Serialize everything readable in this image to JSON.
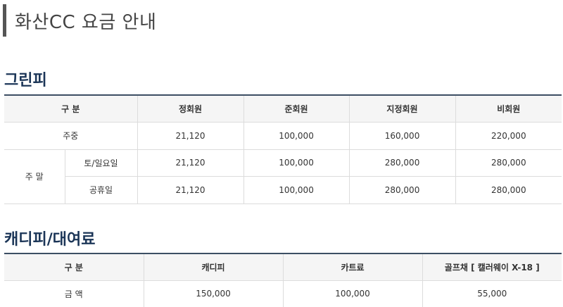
{
  "page": {
    "title": "화산CC 요금 안내"
  },
  "greenfee": {
    "title": "그린피",
    "headers": {
      "category": "구 분",
      "col1": "정회원",
      "col2": "준회원",
      "col3": "지정회원",
      "col4": "비회원"
    },
    "rows": {
      "weekday": {
        "label": "주중",
        "v1": "21,120",
        "v2": "100,000",
        "v3": "160,000",
        "v4": "220,000"
      },
      "weekend_label": "주 말",
      "weekend_sat_sun": {
        "label": "토/일요일",
        "v1": "21,120",
        "v2": "100,000",
        "v3": "280,000",
        "v4": "280,000"
      },
      "weekend_holiday": {
        "label": "공휴일",
        "v1": "21,120",
        "v2": "100,000",
        "v3": "280,000",
        "v4": "280,000"
      }
    }
  },
  "caddie": {
    "title": "캐디피/대여료",
    "headers": {
      "category": "구 분",
      "col1": "캐디피",
      "col2": "카트료",
      "col3": "골프채 [ 캘러웨이 X-18 ]"
    },
    "row": {
      "label": "금 액",
      "v1": "150,000",
      "v2": "100,000",
      "v3": "55,000"
    }
  }
}
